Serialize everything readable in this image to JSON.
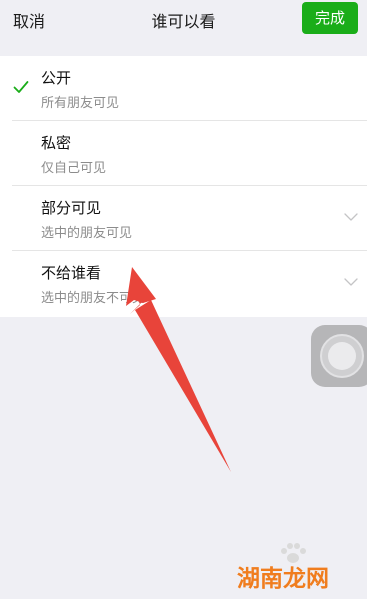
{
  "navbar": {
    "cancel_label": "取消",
    "title": "谁可以看",
    "done_label": "完成"
  },
  "options": [
    {
      "title": "公开",
      "subtitle": "所有朋友可见",
      "selected": true,
      "icon": "check-icon"
    },
    {
      "title": "私密",
      "subtitle": "仅自己可见",
      "selected": false
    },
    {
      "title": "部分可见",
      "subtitle": "选中的朋友可见",
      "selected": false,
      "icon": "chevron-down-icon"
    },
    {
      "title": "不给谁看",
      "subtitle": "选中的朋友不可见",
      "selected": false,
      "icon": "chevron-down-icon"
    }
  ],
  "watermark": {
    "text": "湖南龙网"
  },
  "colors": {
    "accent": "#1aad19",
    "background": "#efeff4",
    "arrow": "#e8443a",
    "watermark": "#f07d1e"
  }
}
